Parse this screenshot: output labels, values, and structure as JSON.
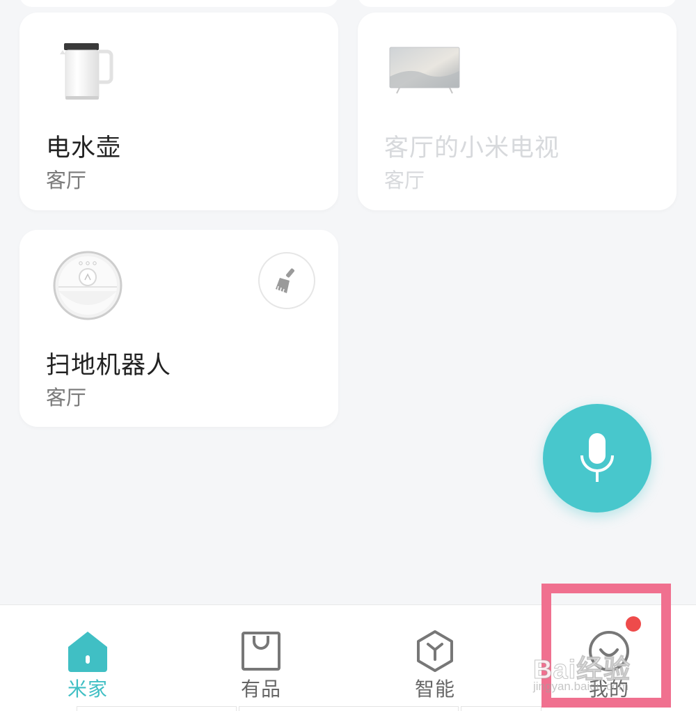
{
  "devices": [
    {
      "name": "电水壶",
      "room": "客厅",
      "icon": "kettle-icon",
      "state": "online"
    },
    {
      "name": "客厅的小米电视",
      "room": "客厅",
      "icon": "tv-icon",
      "state": "offline"
    },
    {
      "name": "扫地机器人",
      "room": "客厅",
      "icon": "robot-vacuum-icon",
      "state": "online",
      "quick_action_icon": "broom-icon"
    }
  ],
  "voice_button": {
    "icon": "microphone-icon",
    "color": "#48c7cc"
  },
  "tabbar": {
    "tabs": [
      {
        "label": "米家",
        "icon": "home-icon",
        "active": true
      },
      {
        "label": "有品",
        "icon": "shopping-bag-icon",
        "active": false
      },
      {
        "label": "智能",
        "icon": "smart-cube-icon",
        "active": false
      },
      {
        "label": "我的",
        "icon": "profile-face-icon",
        "active": false,
        "badge": "red-dot"
      }
    ],
    "active_color": "#40bfc4"
  },
  "annotation": {
    "highlight_color": "#f0708f",
    "target": "我的"
  },
  "watermark": {
    "brand": "Bai经验",
    "url": "jingyan.baidu.com"
  }
}
